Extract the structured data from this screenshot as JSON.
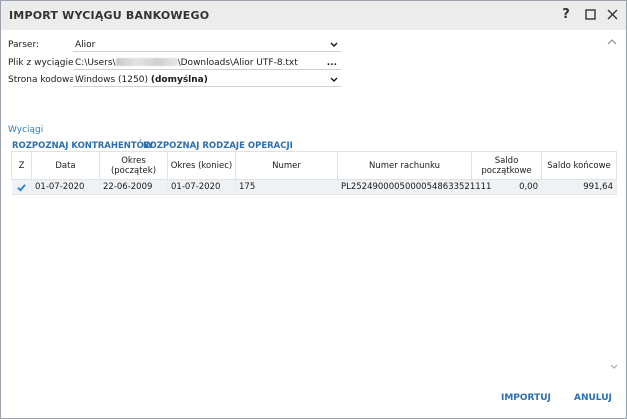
{
  "window": {
    "title": "IMPORT WYCIĄGU BANKOWEGO",
    "help_label": "?"
  },
  "form": {
    "parser_label": "Parser:",
    "parser_value": "Alior",
    "file_label": "Plik z wyciągiem:",
    "file_prefix": "C:\\Users\\",
    "file_suffix": "\\Downloads\\Alior UTF-8.txt",
    "browse_label": "...",
    "codepage_label": "Strona kodowa:",
    "codepage_value": "Windows (1250)",
    "codepage_default": "(domyślna)"
  },
  "section": {
    "title": "Wyciągi",
    "actions": [
      "ROZPOZNAJ KONTRAHENTÓW",
      "ROZPOZNAJ RODZAJE OPERACJI"
    ]
  },
  "table": {
    "headers": [
      "Z",
      "Data",
      "Okres (początek)",
      "Okres (koniec)",
      "Numer",
      "Numer rachunku",
      "Saldo początkowe",
      "Saldo końcowe"
    ],
    "rows": [
      {
        "checked": true,
        "data": "01-07-2020",
        "okres_poczatek": "22-06-2009",
        "okres_koniec": "01-07-2020",
        "numer": "175",
        "numer_rachunku": "PL25249000050000548633521111",
        "saldo_poczatkowe": "0,00",
        "saldo_koncowe": "991,64"
      }
    ]
  },
  "footer": {
    "import_label": "IMPORTUJ",
    "cancel_label": "ANULUJ"
  },
  "colors": {
    "accent": "#2a6fb0",
    "checkbox": "#1e7fd1",
    "row_highlight": "#eef2f5"
  }
}
